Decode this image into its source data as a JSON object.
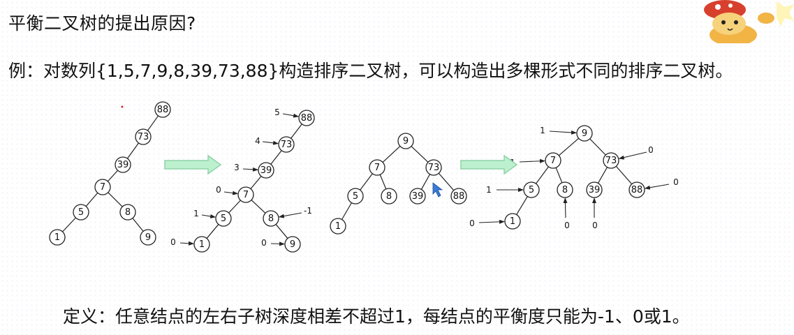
{
  "slide": {
    "title": "平衡二叉树的提出原因?",
    "example": "例：对数列{1,5,7,9,8,39,73,88}构造排序二叉树，可以构造出多棵形式不同的排序二叉树。",
    "definition": "定义：任意结点的左右子树深度相差不超过1，每结点的平衡度只能为-1、0或1。"
  },
  "colors": {
    "arrow_fill": "#bdf0cf",
    "arrow_stroke": "#8fd3a8"
  },
  "trees": [
    {
      "id": "tree1",
      "nodes": [
        "88",
        "73",
        "39",
        "7",
        "5",
        "8",
        "1",
        "9"
      ],
      "edges": [
        [
          "88",
          "73"
        ],
        [
          "73",
          "39"
        ],
        [
          "39",
          "7"
        ],
        [
          "7",
          "5"
        ],
        [
          "7",
          "8"
        ],
        [
          "5",
          "1"
        ],
        [
          "8",
          "9"
        ]
      ],
      "balance": {}
    },
    {
      "id": "tree2",
      "nodes": [
        "88",
        "73",
        "39",
        "7",
        "5",
        "8",
        "1",
        "9"
      ],
      "edges": [
        [
          "88",
          "73"
        ],
        [
          "73",
          "39"
        ],
        [
          "39",
          "7"
        ],
        [
          "7",
          "5"
        ],
        [
          "7",
          "8"
        ],
        [
          "5",
          "1"
        ],
        [
          "8",
          "9"
        ]
      ],
      "balance": {
        "88": "5",
        "73": "4",
        "39": "3",
        "7": "0",
        "5": "1",
        "8": "-1",
        "1": "0",
        "9": "0"
      }
    },
    {
      "id": "tree3",
      "nodes": [
        "9",
        "7",
        "73",
        "5",
        "8",
        "39",
        "88",
        "1"
      ],
      "edges": [
        [
          "9",
          "7"
        ],
        [
          "9",
          "73"
        ],
        [
          "7",
          "5"
        ],
        [
          "7",
          "8"
        ],
        [
          "73",
          "39"
        ],
        [
          "73",
          "88"
        ],
        [
          "5",
          "1"
        ]
      ],
      "balance": {}
    },
    {
      "id": "tree4",
      "nodes": [
        "9",
        "7",
        "73",
        "5",
        "8",
        "39",
        "88",
        "1"
      ],
      "edges": [
        [
          "9",
          "7"
        ],
        [
          "9",
          "73"
        ],
        [
          "7",
          "5"
        ],
        [
          "7",
          "8"
        ],
        [
          "73",
          "39"
        ],
        [
          "73",
          "88"
        ],
        [
          "5",
          "1"
        ]
      ],
      "balance": {
        "9": "1",
        "7": "1",
        "73": "0",
        "5": "1",
        "8": "0",
        "39": "0",
        "88": "0",
        "1": "0"
      }
    }
  ]
}
